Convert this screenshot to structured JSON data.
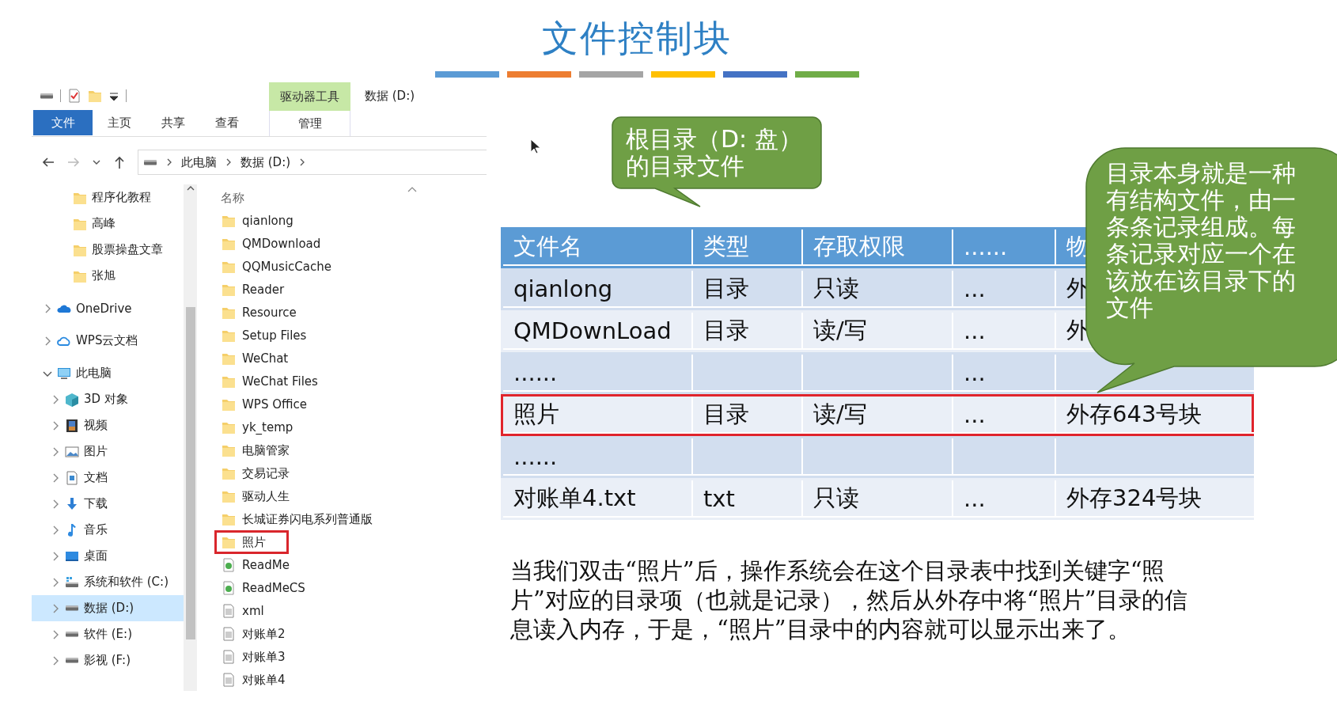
{
  "slide": {
    "title": "文件控制块",
    "accent_bars": [
      {
        "color": "#5b9bd5"
      },
      {
        "color": "#ed7d31"
      },
      {
        "color": "#a5a5a5"
      },
      {
        "color": "#ffc000"
      },
      {
        "color": "#4472c4"
      },
      {
        "color": "#70ad47"
      }
    ]
  },
  "explorer": {
    "window_title": "数据 (D:)",
    "ribbon": {
      "tabs": [
        {
          "label": "文件",
          "kind": "file-menu",
          "selected": false
        },
        {
          "label": "主页",
          "kind": "tab",
          "selected": false
        },
        {
          "label": "共享",
          "kind": "tab",
          "selected": false
        },
        {
          "label": "查看",
          "kind": "tab",
          "selected": false
        }
      ],
      "context_group": {
        "label": "驱动器工具",
        "tabs": [
          {
            "label": "管理",
            "kind": "tab",
            "selected": false
          }
        ]
      }
    },
    "address": {
      "breadcrumbs": [
        "此电脑",
        "数据 (D:)"
      ]
    },
    "nav": {
      "pinned_folders": [
        {
          "label": "程序化教程",
          "selected": false
        },
        {
          "label": "高峰",
          "selected": false
        },
        {
          "label": "股票操盘文章",
          "selected": false
        },
        {
          "label": "张旭",
          "selected": false
        }
      ],
      "items": [
        {
          "label": "OneDrive",
          "kind": "onedrive",
          "expanded": false,
          "selected": false
        },
        {
          "label": "WPS云文档",
          "kind": "cloud",
          "expanded": false,
          "selected": false
        },
        {
          "label": "此电脑",
          "kind": "pc",
          "expanded": true,
          "selected": false,
          "children": [
            {
              "label": "3D 对象",
              "kind": "cube",
              "expanded": false,
              "selected": false
            },
            {
              "label": "视频",
              "kind": "film",
              "expanded": false,
              "selected": false
            },
            {
              "label": "图片",
              "kind": "image",
              "expanded": false,
              "selected": false
            },
            {
              "label": "文档",
              "kind": "document",
              "expanded": false,
              "selected": false
            },
            {
              "label": "下载",
              "kind": "download",
              "expanded": false,
              "selected": false
            },
            {
              "label": "音乐",
              "kind": "music",
              "expanded": false,
              "selected": false
            },
            {
              "label": "桌面",
              "kind": "desktop",
              "expanded": false,
              "selected": false
            },
            {
              "label": "系统和软件 (C:)",
              "kind": "system-drive",
              "expanded": false,
              "selected": false
            },
            {
              "label": "数据 (D:)",
              "kind": "drive",
              "expanded": false,
              "selected": true
            },
            {
              "label": "软件 (E:)",
              "kind": "drive",
              "expanded": false,
              "selected": false
            },
            {
              "label": "影视 (F:)",
              "kind": "drive",
              "expanded": false,
              "selected": false
            }
          ]
        }
      ]
    },
    "file_list": {
      "column": "名称",
      "files": [
        {
          "name": "qianlong",
          "kind": "folder",
          "highlighted": false
        },
        {
          "name": "QMDownload",
          "kind": "folder",
          "highlighted": false
        },
        {
          "name": "QQMusicCache",
          "kind": "folder",
          "highlighted": false
        },
        {
          "name": "Reader",
          "kind": "folder",
          "highlighted": false
        },
        {
          "name": "Resource",
          "kind": "folder",
          "highlighted": false
        },
        {
          "name": "Setup Files",
          "kind": "folder",
          "highlighted": false
        },
        {
          "name": "WeChat",
          "kind": "folder",
          "highlighted": false
        },
        {
          "name": "WeChat Files",
          "kind": "folder",
          "highlighted": false
        },
        {
          "name": "WPS Office",
          "kind": "folder",
          "highlighted": false
        },
        {
          "name": "yk_temp",
          "kind": "folder",
          "highlighted": false
        },
        {
          "name": "电脑管家",
          "kind": "folder",
          "highlighted": false
        },
        {
          "name": "交易记录",
          "kind": "folder",
          "highlighted": false
        },
        {
          "name": "驱动人生",
          "kind": "folder",
          "highlighted": false
        },
        {
          "name": "长城证券闪电系列普通版",
          "kind": "folder",
          "highlighted": false
        },
        {
          "name": "照片",
          "kind": "folder",
          "highlighted": true
        },
        {
          "name": "ReadMe",
          "kind": "web",
          "highlighted": false
        },
        {
          "name": "ReadMeCS",
          "kind": "web",
          "highlighted": false
        },
        {
          "name": "xml",
          "kind": "text",
          "highlighted": false
        },
        {
          "name": "对账单2",
          "kind": "text",
          "highlighted": false
        },
        {
          "name": "对账单3",
          "kind": "text",
          "highlighted": false
        },
        {
          "name": "对账单4",
          "kind": "text",
          "highlighted": false
        }
      ]
    }
  },
  "callouts": [
    {
      "text": "根目录（D: 盘）的目录文件"
    },
    {
      "text": "目录本身就是一种有结构文件，由一条条记录组成。每条记录对应一个在该放在该目录下的文件"
    }
  ],
  "table": {
    "columns": [
      "文件名",
      "类型",
      "存取权限",
      "......",
      "物"
    ],
    "rows": [
      {
        "cells": [
          "qianlong",
          "目录",
          "只读",
          "...",
          "外"
        ],
        "highlighted": false
      },
      {
        "cells": [
          "QMDownLoad",
          "目录",
          "读/写",
          "...",
          "外"
        ],
        "highlighted": false
      },
      {
        "cells": [
          "......",
          "",
          "",
          "...",
          ""
        ],
        "highlighted": false
      },
      {
        "cells": [
          "照片",
          "目录",
          "读/写",
          "...",
          "外存643号块"
        ],
        "highlighted": true
      },
      {
        "cells": [
          "......",
          "",
          "",
          "",
          ""
        ],
        "highlighted": false
      },
      {
        "cells": [
          "对账单4.txt",
          "txt",
          "只读",
          "...",
          "外存324号块"
        ],
        "highlighted": false
      }
    ]
  },
  "note": "当我们双击“照片”后，操作系统会在这个目录表中找到关键字“照片”对应的目录项（也就是记录），然后从外存中将“照片”目录的信息读入内存，于是，“照片”目录中的内容就可以显示出来了。"
}
